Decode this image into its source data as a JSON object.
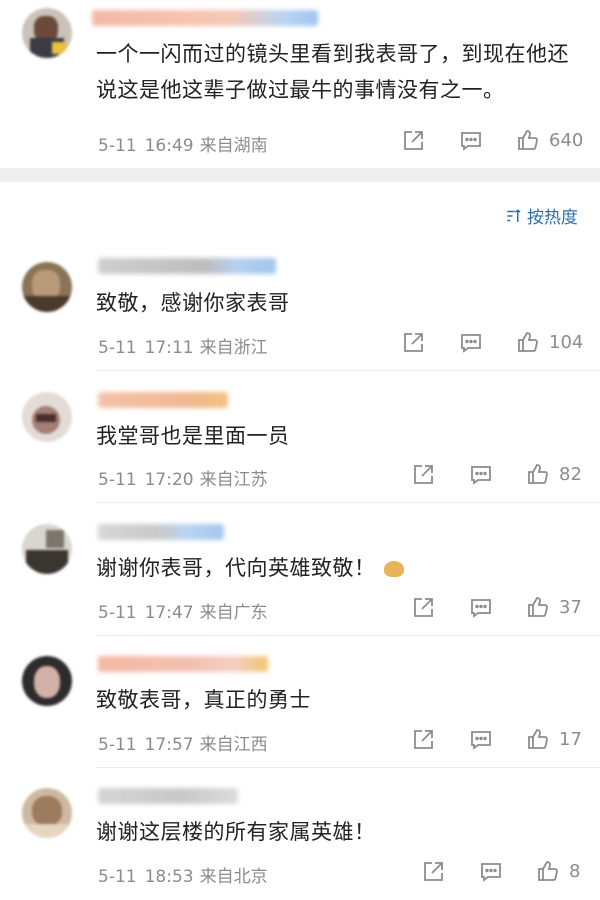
{
  "post": {
    "text": "一个一闪而过的镜头里看到我表哥了，到现在他还说这是他这辈子做过最牛的事情没有之一。",
    "date": "5-11",
    "time": "16:49",
    "location": "来自湖南",
    "likes": "640"
  },
  "sort": {
    "label": "按热度"
  },
  "comments": [
    {
      "text": "致敬，感谢你家表哥",
      "date": "5-11",
      "time": "17:11",
      "location": "来自浙江",
      "likes": "104"
    },
    {
      "text": "我堂哥也是里面一员",
      "date": "5-11",
      "time": "17:20",
      "location": "来自江苏",
      "likes": "82"
    },
    {
      "text": "谢谢你表哥，代向英雄致敬！",
      "date": "5-11",
      "time": "17:47",
      "location": "来自广东",
      "likes": "37"
    },
    {
      "text": "致敬表哥，真正的勇士",
      "date": "5-11",
      "time": "17:57",
      "location": "来自江西",
      "likes": "17"
    },
    {
      "text": "谢谢这层楼的所有家属英雄！",
      "date": "5-11",
      "time": "18:53",
      "location": "来自北京",
      "likes": "8"
    }
  ],
  "icons": {
    "share": "share-icon",
    "comment": "comment-icon",
    "like": "thumbs-up-icon",
    "sort": "sort-icon",
    "emoji": "folded-hands-emoji-icon"
  },
  "colors": {
    "sort_link": "#2f6ea8",
    "meta_text": "#8c8c8c",
    "separator": "#eeeeee"
  }
}
